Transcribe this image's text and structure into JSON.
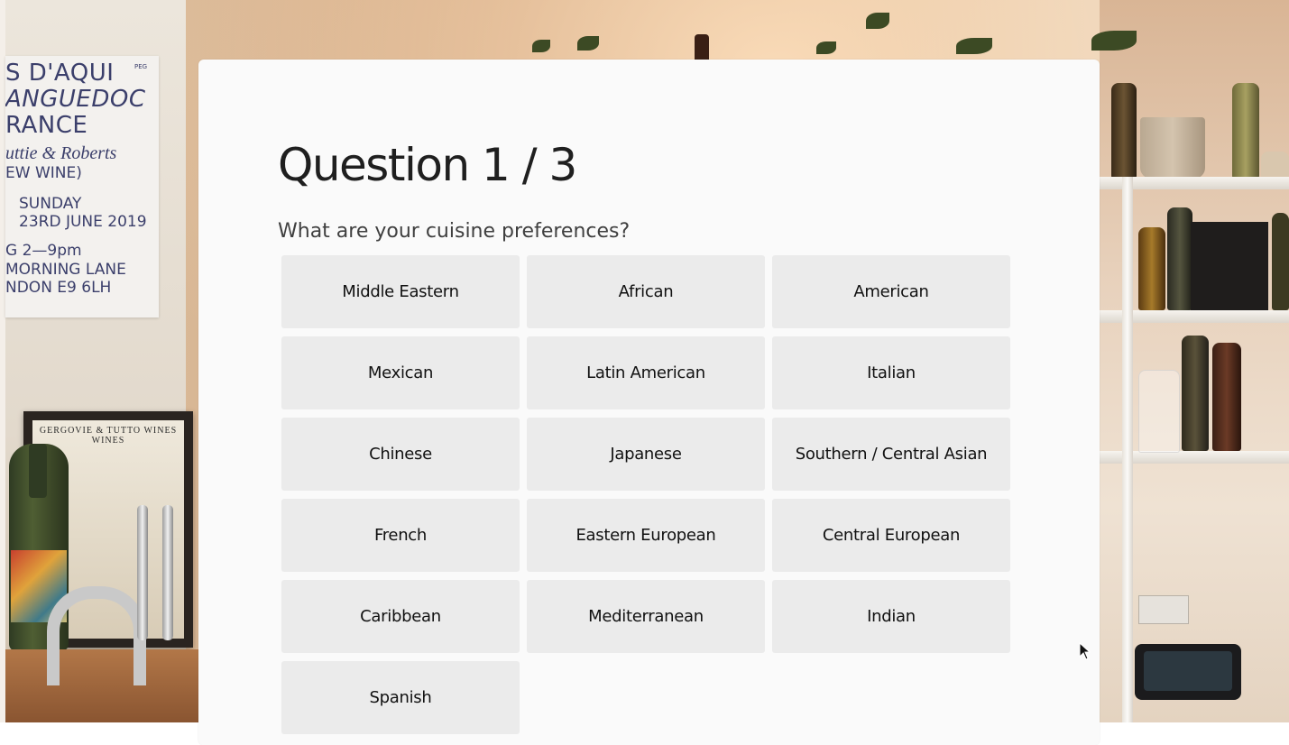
{
  "background": {
    "poster": {
      "lines": [
        "S D'AQUI",
        "ANGUEDOC",
        "RANCE",
        "uttie  &  Roberts",
        "EW           WINE)",
        "SUNDAY",
        "23RD JUNE 2019",
        "G            2—9pm",
        "MORNING LANE",
        "NDON E9 6LH"
      ],
      "tag": "PEG"
    },
    "frame_title": "GERGOVIE & TUTTO WINES   WINES"
  },
  "question": {
    "title": "Question 1 / 3",
    "prompt": "What are your cuisine preferences?"
  },
  "options": [
    "Middle Eastern",
    "African",
    "American",
    "Mexican",
    "Latin American",
    "Italian",
    "Chinese",
    "Japanese",
    "Southern / Central Asian",
    "French",
    "Eastern European",
    "Central European",
    "Caribbean",
    "Mediterranean",
    "Indian",
    "Spanish"
  ],
  "colors": {
    "card_bg": "#fafafa",
    "option_bg": "#ebebeb",
    "text": "#1f1f1f"
  }
}
